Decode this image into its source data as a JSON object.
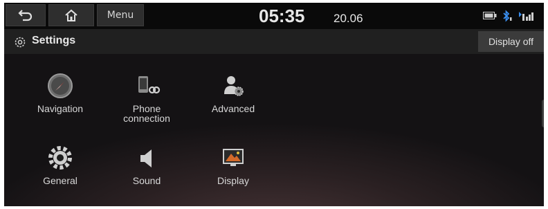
{
  "statusbar": {
    "back_icon": "back-arrow-icon",
    "home_icon": "home-icon",
    "menu_label": "Menu",
    "time": "05:35",
    "date": "20.06",
    "battery_icon": "battery-icon",
    "bluetooth_icon": "bluetooth-icon",
    "signal_icon": "signal-icon"
  },
  "header": {
    "icon": "gear-icon",
    "title": "Settings",
    "display_off_label": "Display off"
  },
  "grid": {
    "items": [
      {
        "label": "Navigation",
        "icon": "navigation-icon"
      },
      {
        "label": "Phone\nconnection",
        "icon": "phone-connection-icon"
      },
      {
        "label": "Advanced",
        "icon": "advanced-icon"
      },
      {
        "label": "General",
        "icon": "gear-icon"
      },
      {
        "label": "Sound",
        "icon": "speaker-icon"
      },
      {
        "label": "Display",
        "icon": "display-icon"
      }
    ]
  },
  "colors": {
    "background": "#141214",
    "statusbar": "#0a0a0a",
    "titlebar": "#202020",
    "button": "#2e2e2e",
    "text": "#d8d8d8",
    "accent_bluetooth": "#3a8ff0"
  }
}
